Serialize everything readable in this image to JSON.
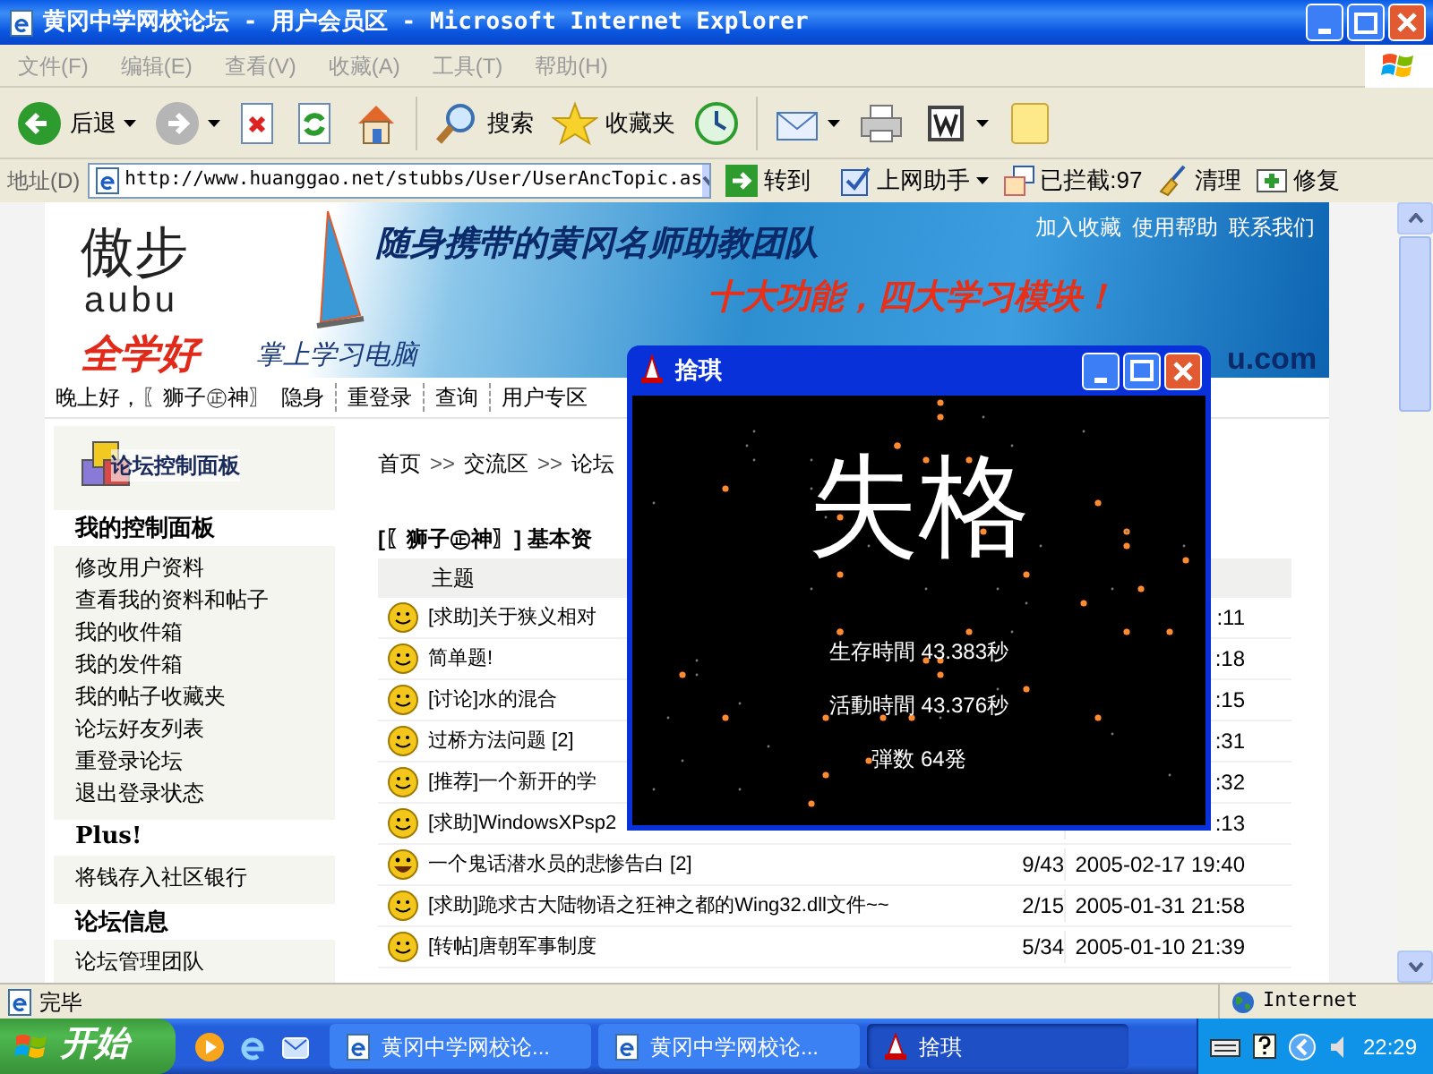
{
  "window": {
    "title": "黄冈中学网校论坛 - 用户会员区 - Microsoft Internet Explorer"
  },
  "menu": [
    "文件(F)",
    "编辑(E)",
    "查看(V)",
    "收藏(A)",
    "工具(T)",
    "帮助(H)"
  ],
  "toolbar": [
    {
      "kind": "back",
      "label": "后退"
    },
    {
      "kind": "forward"
    },
    {
      "kind": "stop"
    },
    {
      "kind": "refresh"
    },
    {
      "kind": "home"
    },
    {
      "kind": "search",
      "label": "搜索"
    },
    {
      "kind": "favorites",
      "label": "收藏夹"
    },
    {
      "kind": "history"
    },
    {
      "kind": "mail"
    },
    {
      "kind": "print"
    },
    {
      "kind": "edit"
    },
    {
      "kind": "note"
    }
  ],
  "address": {
    "label": "地址(D)",
    "value": "http://www.huanggao.net/stubbs/User/UserAncTopic.as",
    "go": "转到",
    "extras": [
      {
        "kind": "assistant",
        "label": "上网助手"
      },
      {
        "kind": "blocked",
        "label": "已拦截:97"
      },
      {
        "kind": "clean",
        "label": "清理"
      },
      {
        "kind": "repair",
        "label": "修复"
      }
    ]
  },
  "banner": {
    "logo_cn": "傲步",
    "logo_en": "aubu",
    "slogan_red": "全学好",
    "slogan_blue": "掌上学习电脑",
    "headline": "随身携带的黄冈名师助教团队",
    "subhead": "十大功能，四大学习模块！",
    "links": [
      "加入收藏",
      "使用帮助",
      "联系我们"
    ],
    "domain": "u.com"
  },
  "nav": {
    "greeting": "晚上好，〖狮子㊣神〗",
    "links": [
      "隐身",
      "重登录",
      "查询",
      "用户专区"
    ]
  },
  "sidebar": {
    "panel_title": "论坛控制面板",
    "sections": [
      {
        "title": "我的控制面板",
        "items": [
          "修改用户资料",
          "查看我的资料和帖子",
          "我的收件箱",
          "我的发件箱",
          "我的帖子收藏夹",
          "论坛好友列表",
          "重登录论坛",
          "退出登录状态"
        ]
      },
      {
        "title": "Plus!",
        "items": [
          "将钱存入社区银行"
        ]
      },
      {
        "title": "论坛信息",
        "items": [
          "论坛管理团队"
        ]
      }
    ]
  },
  "main": {
    "breadcrumb": [
      "首页",
      "交流区",
      "论坛"
    ],
    "separator": ">>",
    "heading": "[〖狮子㊣神〗] 基本资",
    "table": {
      "columns": [
        "主题"
      ],
      "rows": [
        {
          "kind": "smile",
          "topic": "[求助]关于狭义相对",
          "date": ":11"
        },
        {
          "kind": "smile",
          "topic": "简单题!",
          "date": ":18"
        },
        {
          "kind": "smile",
          "topic": "[讨论]水的混合",
          "date": ":15"
        },
        {
          "kind": "smile",
          "topic": "过桥方法问题 [2]",
          "date": ":31"
        },
        {
          "kind": "smile",
          "topic": "[推荐]一个新开的学",
          "date": ":32"
        },
        {
          "kind": "smile",
          "topic": "[求助]WindowsXPsp2",
          "date": ":13"
        },
        {
          "kind": "grin",
          "topic": "一个鬼话潜水员的悲惨告白 [2]",
          "replies": "9/43",
          "date": "2005-02-17 19:40"
        },
        {
          "kind": "smile",
          "topic": "[求助]跪求古大陆物语之狂神之都的Wing32.dll文件~~",
          "replies": "2/15",
          "date": "2005-01-31 21:58"
        },
        {
          "kind": "smile",
          "topic": "[转帖]唐朝军事制度",
          "replies": "5/34",
          "date": "2005-01-10 21:39"
        }
      ]
    }
  },
  "popup": {
    "title": "捨琪",
    "result": "失格",
    "stats": [
      "生存時間 43.383秒",
      "活動時間 43.376秒",
      "弾数 64発"
    ]
  },
  "status_bar": {
    "text": "完毕",
    "zone": "Internet"
  },
  "taskbar": {
    "start": "开始",
    "tasks": [
      {
        "kind": "browser",
        "label": "黄冈中学网校论...",
        "selected": false
      },
      {
        "kind": "browser",
        "label": "黄冈中学网校论...",
        "selected": false
      },
      {
        "kind": "game",
        "label": "捨琪",
        "selected": true
      }
    ],
    "clock": "22:29"
  }
}
